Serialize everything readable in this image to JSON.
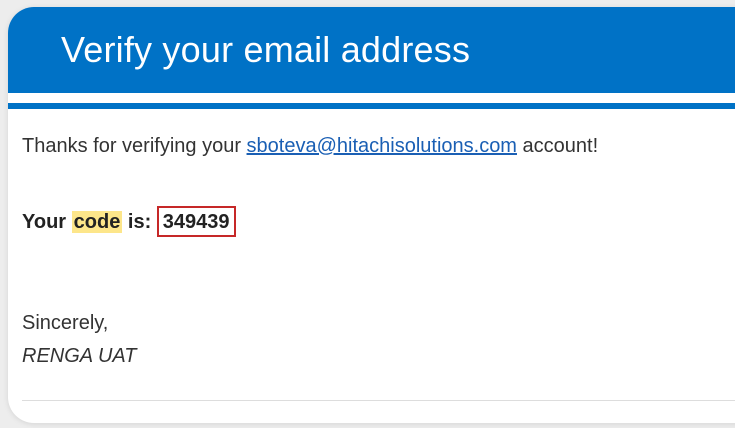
{
  "header": {
    "title": "Verify your email address",
    "color": "#0072c6"
  },
  "message": {
    "thanks_prefix": "Thanks for verifying your ",
    "email": "sboteva@hitachisolutions.com",
    "thanks_suffix": " account!",
    "code_prefix": "Your ",
    "code_word": "code",
    "code_suffix": " is: ",
    "code": "349439"
  },
  "signature": {
    "closing": "Sincerely,",
    "name": "RENGA UAT"
  },
  "colors": {
    "highlight": "#fde68a",
    "code_box_border": "#c62828",
    "link": "#1a5fb4"
  }
}
